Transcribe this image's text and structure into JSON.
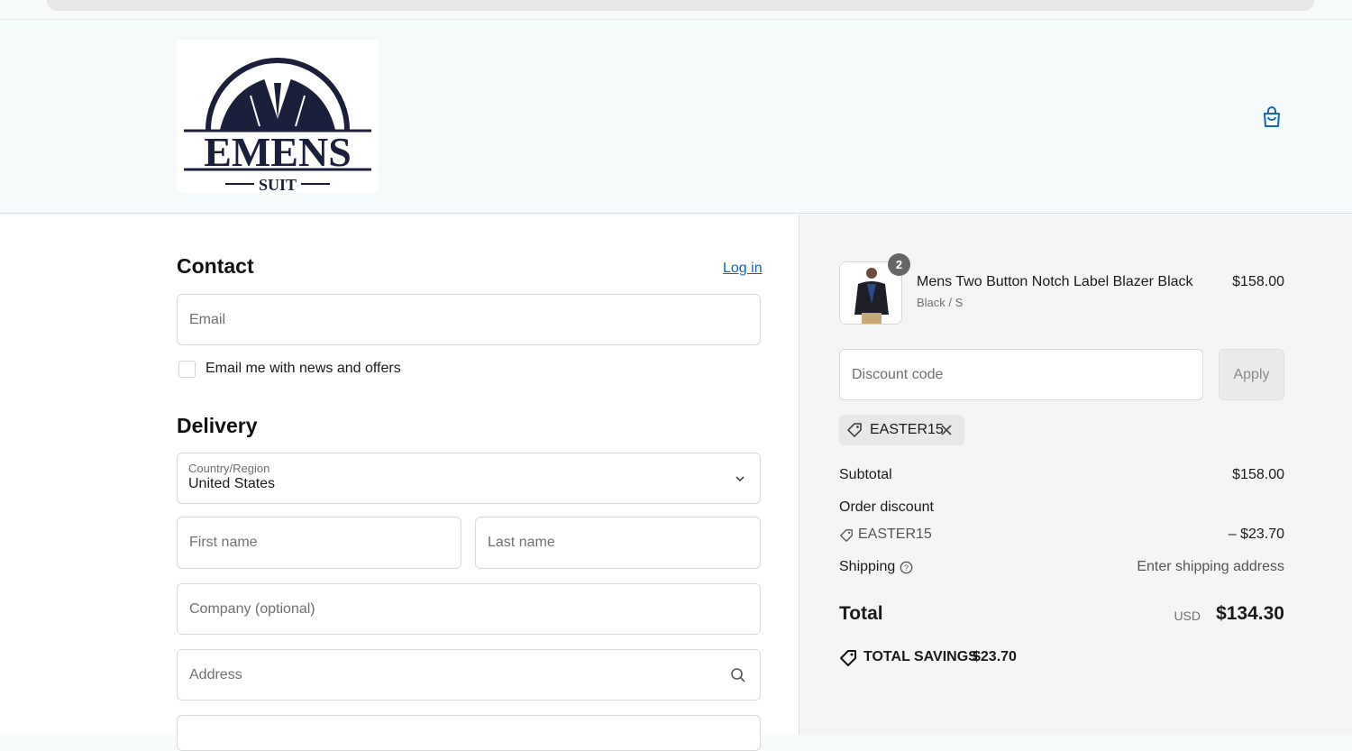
{
  "brand": {
    "name": "EMENS",
    "sub": "SUIT"
  },
  "contact": {
    "title": "Contact",
    "login_label": "Log in",
    "email_placeholder": "Email",
    "newsletter_label": "Email me with news and offers"
  },
  "delivery": {
    "title": "Delivery",
    "country_label": "Country/Region",
    "country_value": "United States",
    "first_name_placeholder": "First name",
    "last_name_placeholder": "Last name",
    "company_placeholder": "Company (optional)",
    "address_placeholder": "Address"
  },
  "order": {
    "item": {
      "name": "Mens Two Button Notch Label Blazer Black",
      "variant": "Black / S",
      "price": "$158.00",
      "quantity": "2"
    },
    "discount_placeholder": "Discount code",
    "apply_label": "Apply",
    "applied_code": "EASTER15",
    "subtotal_label": "Subtotal",
    "subtotal_value": "$158.00",
    "order_discount_label": "Order discount",
    "discount_code": "EASTER15",
    "discount_value": "– $23.70",
    "shipping_label": "Shipping",
    "shipping_value": "Enter shipping address",
    "total_label": "Total",
    "currency": "USD",
    "total_value": "$134.30",
    "savings_label": "TOTAL SAVINGS",
    "savings_value": "$23.70"
  },
  "colors": {
    "link": "#1566b2",
    "navy": "#1b1f3b"
  }
}
